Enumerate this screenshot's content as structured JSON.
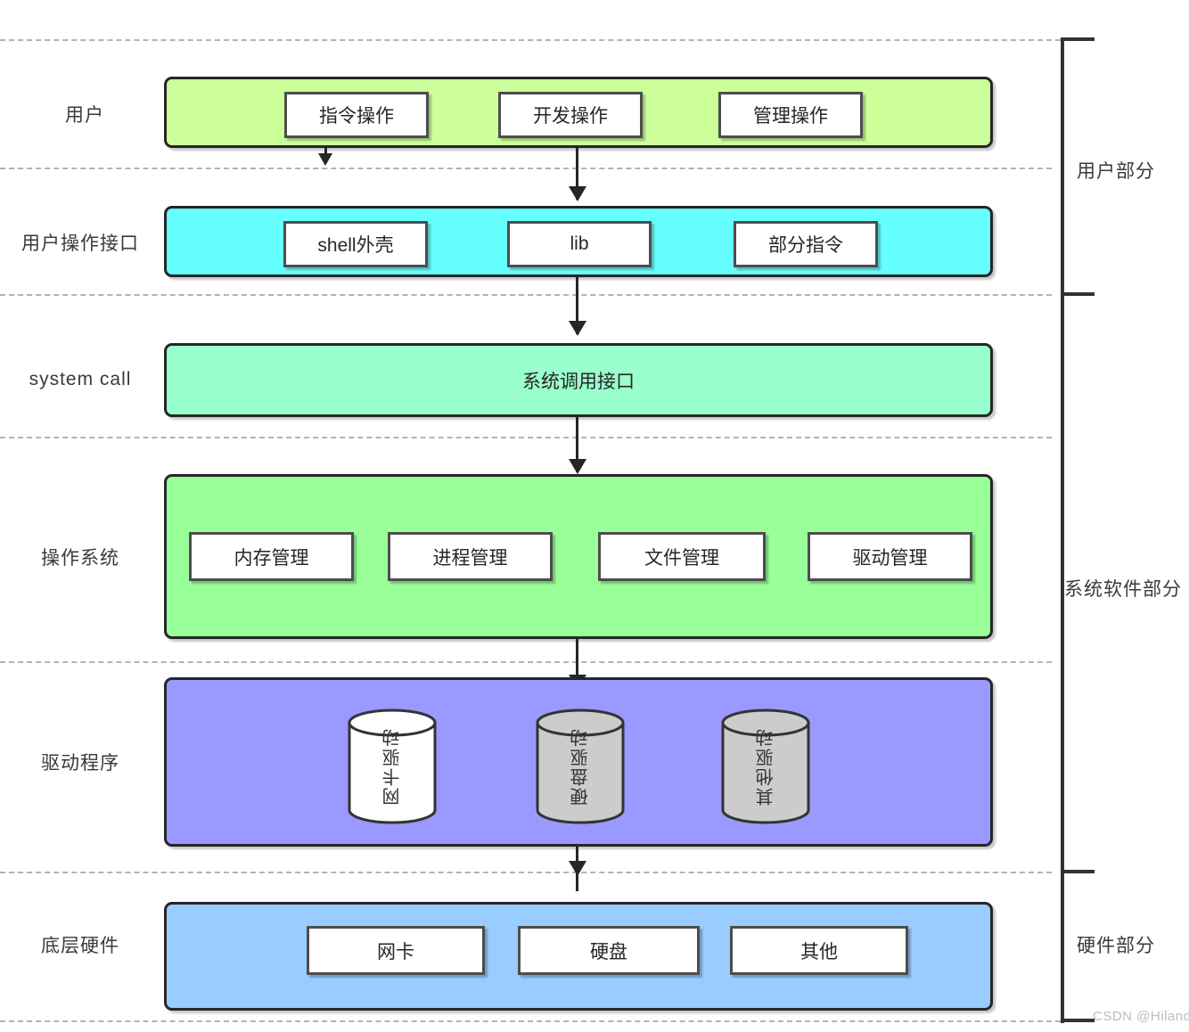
{
  "diagram": {
    "title_watermark": "CSDN @Hiland.",
    "rows": [
      {
        "id": "user",
        "label": "用户",
        "band_color": "#CCFF99",
        "cells": [
          "指令操作",
          "开发操作",
          "管理操作"
        ]
      },
      {
        "id": "user-interface",
        "label": "用户操作接口",
        "band_color": "#66FFFF",
        "cells": [
          "shell外壳",
          "lib",
          "部分指令"
        ]
      },
      {
        "id": "system-call",
        "label": "system call",
        "band_color": "#99FFCC",
        "cells": [],
        "band_text": "系统调用接口"
      },
      {
        "id": "operating-system",
        "label": "操作系统",
        "band_color": "#99FF99",
        "cells": [
          "内存管理",
          "进程管理",
          "文件管理",
          "驱动管理"
        ]
      },
      {
        "id": "drivers",
        "label": "驱动程序",
        "band_color": "#9999FF",
        "cells": [],
        "cylinders": [
          {
            "label": "网卡驱动",
            "color": "#FFFFFF"
          },
          {
            "label": "硬盘驱动",
            "color": "#CCCCCC"
          },
          {
            "label": "其他驱动",
            "color": "#CCCCCC"
          }
        ]
      },
      {
        "id": "hardware",
        "label": "底层硬件",
        "band_color": "#99CCFF",
        "cells": [
          "网卡",
          "硬盘",
          "其他"
        ]
      }
    ],
    "groups": [
      {
        "id": "user-part",
        "label": "用户部分"
      },
      {
        "id": "system-software-part",
        "label": "系统软件部分"
      },
      {
        "id": "hardware-part",
        "label": "硬件部分"
      }
    ]
  }
}
